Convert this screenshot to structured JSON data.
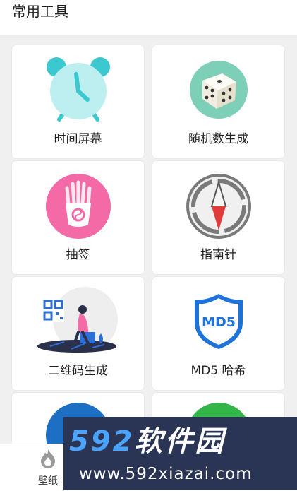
{
  "header": {
    "title": "常用工具"
  },
  "tools": [
    {
      "label": "时间屏幕",
      "icon": "alarm-clock-icon",
      "color": "#b9ecef",
      "accent": "#3bc8cf"
    },
    {
      "label": "随机数生成",
      "icon": "dice-icon",
      "color": "#7ecfb8"
    },
    {
      "label": "抽签",
      "icon": "fortune-sticks-icon",
      "color": "#f46aa7"
    },
    {
      "label": "指南针",
      "icon": "compass-icon",
      "color": "#7a7a7a",
      "accent": "#e23b3b"
    },
    {
      "label": "二维码生成",
      "icon": "qr-code-illustration-icon",
      "color": "#2d6fd6"
    },
    {
      "label": "MD5 哈希",
      "icon": "md5-shield-icon",
      "color": "#1d73d9"
    },
    {
      "label": "",
      "icon": "blue-circle-icon",
      "color": "#1d6fc4"
    },
    {
      "label": "",
      "icon": "green-circle-icon",
      "color": "#33b54a"
    }
  ],
  "bottom_nav": {
    "items": [
      {
        "label": "壁纸",
        "icon": "flame-icon"
      }
    ]
  },
  "watermark": {
    "brand_num": "592",
    "brand_text": "软件园",
    "url": "www.592xiazai.com"
  }
}
